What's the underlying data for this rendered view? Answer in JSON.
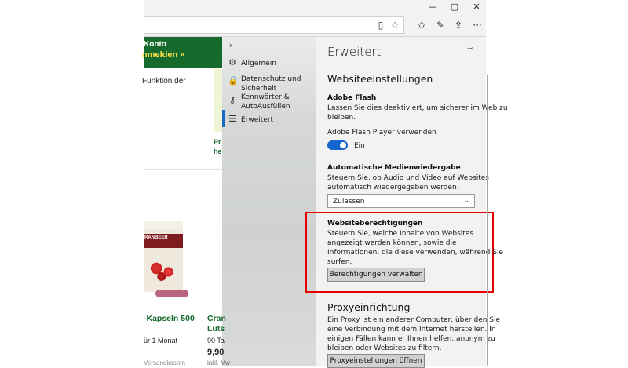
{
  "window": {
    "minimize": "—",
    "maximize": "▢",
    "close": "✕"
  },
  "toolbar": {
    "reader_icon": "reading-view-icon",
    "favorite_icon": "star-icon",
    "favorites_list_icon": "favorites-icon",
    "pen_icon": "pen-icon",
    "share_icon": "share-icon",
    "more_icon": "more-icon"
  },
  "page": {
    "konto": "Konto",
    "anmelden": "nmelden »",
    "funktion": "Funktion der",
    "green_snippet_1": "Pr",
    "green_snippet_2": "he",
    "product_label": "RANBEER",
    "product_1_title": "-Kapseln 500",
    "product_1_sub": "ür 1 Monat",
    "product_1_foot": "Versandkosten",
    "product_2_title_1": "Cran",
    "product_2_title_2": "Luts",
    "product_2_sub": "90 Ta",
    "product_2_price": "9,90",
    "product_2_foot": "inkl. Mw"
  },
  "nav": {
    "collapse_icon": "chevron-right-icon",
    "items": [
      {
        "label": "Allgemein",
        "icon": "gear-icon"
      },
      {
        "label_1": "Datenschutz und",
        "label_2": "Sicherheit",
        "icon": "lock-icon"
      },
      {
        "label_1": "Kennwörter &",
        "label_2": "AutoAusfüllen",
        "icon": "key-icon"
      },
      {
        "label": "Erweitert",
        "icon": "sliders-icon"
      }
    ]
  },
  "settings": {
    "title": "Erweitert",
    "pin_icon": "pin-icon",
    "section_title": "Websiteeinstellungen",
    "flash": {
      "title": "Adobe Flash",
      "desc_1": "Lassen Sie dies deaktiviert, um sicherer im Web zu",
      "desc_2": "bleiben.",
      "toggle_label": "Adobe Flash Player verwenden",
      "toggle_state": "Ein"
    },
    "autoplay": {
      "title": "Automatische Medienwiedergabe",
      "desc_1": "Steuern Sie, ob Audio und Video auf Websites",
      "desc_2": "automatisch wiedergegeben werden.",
      "select_value": "Zulassen"
    },
    "permissions": {
      "title": "Websiteberechtigungen",
      "desc_1": "Steuern Sie, welche Inhalte von Websites",
      "desc_2": "angezeigt werden können, sowie die",
      "desc_3": "Informationen, die diese verwenden, während Sie",
      "desc_4": "surfen.",
      "button": "Berechtigungen verwalten"
    },
    "proxy": {
      "title": "Proxyeinrichtung",
      "desc_1": "Ein Proxy ist ein anderer Computer, über den Sie",
      "desc_2": "eine Verbindung mit dem Internet herstellen. In",
      "desc_3": "einigen Fällen kann er Ihnen helfen, anonym zu",
      "desc_4": "bleiben oder Websites zu filtern.",
      "button": "Proxyeinstellungen öffnen"
    }
  },
  "colors": {
    "accent": "#1466d0",
    "highlight": "#e60000",
    "brand_green": "#166a2c"
  }
}
